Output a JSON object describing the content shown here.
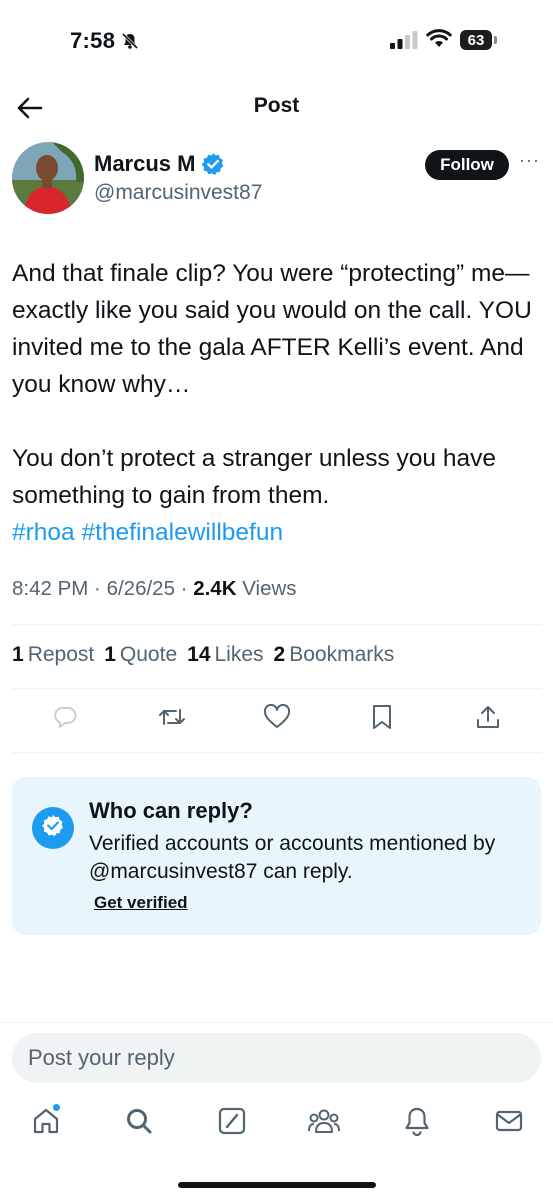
{
  "status_bar": {
    "time": "7:58",
    "battery": "63"
  },
  "header": {
    "title": "Post"
  },
  "author": {
    "name": "Marcus M",
    "handle": "@marcusinvest87",
    "follow_label": "Follow"
  },
  "tweet": {
    "paragraph1": "And that finale clip? You were “protecting” me—exactly like you said you would on the call. YOU invited me to the gala AFTER Kelli’s event. And you know why…",
    "paragraph2": "You don’t protect a stranger unless you have something to gain from them.",
    "hashtags": [
      "#rhoa",
      "#thefinalewillbefun"
    ],
    "time": "8:42 PM",
    "date": "6/26/25",
    "views_count": "2.4K",
    "views_label": "Views"
  },
  "stats": [
    {
      "count": "1",
      "label": "Repost"
    },
    {
      "count": "1",
      "label": "Quote"
    },
    {
      "count": "14",
      "label": "Likes"
    },
    {
      "count": "2",
      "label": "Bookmarks"
    }
  ],
  "reply_restriction": {
    "title": "Who can reply?",
    "description": "Verified accounts or accounts mentioned by @marcusinvest87 can reply.",
    "link": "Get verified"
  },
  "composer": {
    "placeholder": "Post your reply"
  },
  "colors": {
    "accent": "#1d9bf0",
    "text": "#0f1419",
    "secondary": "#536471",
    "card_bg": "#e8f5fd"
  },
  "icons": {
    "actions": [
      "reply-icon",
      "repost-icon",
      "like-icon",
      "bookmark-icon",
      "share-icon"
    ],
    "tabs": [
      "home-icon",
      "search-icon",
      "grok-icon",
      "communities-icon",
      "notifications-icon",
      "messages-icon"
    ]
  }
}
